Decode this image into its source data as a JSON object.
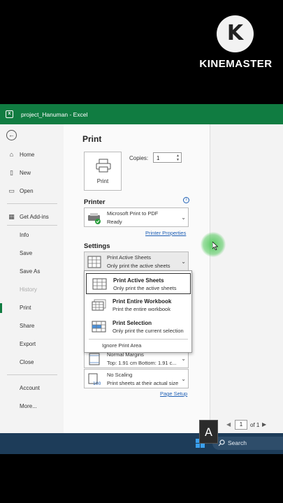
{
  "watermark": {
    "logo_letter": "K",
    "text": "KINEMASTER"
  },
  "window": {
    "title": "project_Hanuman  -  Excel",
    "accent": "#107c41"
  },
  "nav": {
    "back_icon": "arrow-left-icon",
    "items": [
      {
        "label": "Home",
        "icon": "home-icon"
      },
      {
        "label": "New",
        "icon": "new-file-icon"
      },
      {
        "label": "Open",
        "icon": "folder-icon"
      },
      {
        "label": "Get Add-ins",
        "icon": "grid-icon"
      },
      {
        "label": "Info"
      },
      {
        "label": "Save"
      },
      {
        "label": "Save As"
      },
      {
        "label": "History",
        "disabled": true
      },
      {
        "label": "Print",
        "active": true
      },
      {
        "label": "Share"
      },
      {
        "label": "Export"
      },
      {
        "label": "Close"
      },
      {
        "label": "Account"
      },
      {
        "label": "More..."
      }
    ]
  },
  "print": {
    "heading": "Print",
    "print_button": "Print",
    "copies_label": "Copies:",
    "copies_value": "1",
    "printer_heading": "Printer",
    "printer_name": "Microsoft Print to PDF",
    "printer_status": "Ready",
    "printer_properties": "Printer Properties",
    "settings_heading": "Settings",
    "scope": {
      "title": "Print Active Sheets",
      "desc": "Only print the active sheets"
    },
    "margins": {
      "title": "Normal Margins",
      "desc": "Top: 1.91 cm Bottom: 1.91 c..."
    },
    "scaling": {
      "title": "No Scaling",
      "desc": "Print sheets at their actual size"
    },
    "page_setup": "Page Setup"
  },
  "menu": {
    "items": [
      {
        "title": "Print Active Sheets",
        "desc": "Only print the active sheets",
        "selected": true
      },
      {
        "title": "Print Entire Workbook",
        "desc": "Print the entire workbook"
      },
      {
        "title": "Print Selection",
        "desc": "Only print the current selection"
      }
    ],
    "ignore": "Ignore Print Area"
  },
  "pager": {
    "current": "1",
    "of": "of 1"
  },
  "taskbar": {
    "search": "Search"
  },
  "overlay_key": "A"
}
